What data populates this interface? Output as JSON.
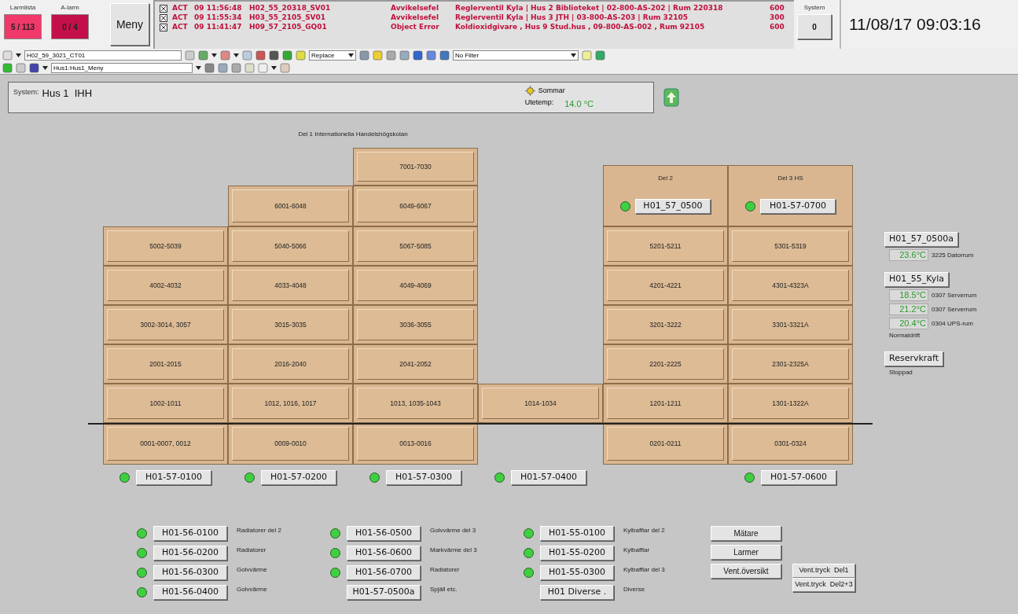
{
  "alarm_counters": [
    {
      "label": "Larmlista",
      "value": "5 / 113",
      "color": "#f0386a"
    },
    {
      "label": "A-larm",
      "value": "0 / 4",
      "color": "#c4104a"
    }
  ],
  "menu_button": "Meny",
  "alarms": [
    {
      "state": "ACT",
      "time": "09 11:56:48",
      "tag": "H02_55_20318_SV01",
      "type": "Avvikelsefel",
      "description": "Reglerventil Kyla  | Hus 2 Biblioteket | 02-800-AS-202 | Rum 220318",
      "priority": "600"
    },
    {
      "state": "ACT",
      "time": "09 11:55:34",
      "tag": "H03_55_2105_SV01",
      "type": "Avvikelsefel",
      "description": "Reglerventil Kyla  | Hus 3 JTH | 03-800-AS-203 | Rum 32105",
      "priority": "300"
    },
    {
      "state": "ACT",
      "time": "09 11:41:47",
      "tag": "H09_57_2105_GQ01",
      "type": "Object Error",
      "description": "Koldioxidgivare , Hus 9 Stud.hus , 09-800-AS-002 , Rum 92105",
      "priority": "600"
    }
  ],
  "system_box": {
    "label": "System",
    "value": "0"
  },
  "clock": "11/08/17 09:03:16",
  "toolbar": {
    "object_field": "H02_59_3021_CT01",
    "replace": "Replace",
    "filter": "No Filter",
    "path_field": "Hus1:Hus1_Meny"
  },
  "system_bar": {
    "label": "System:",
    "name": "Hus 1  IHH",
    "season": "Sommar",
    "temp_label": "Utetemp:",
    "temp": "14.0 °C"
  },
  "building": {
    "title": "Del 1  Internationella Handelshögskolan",
    "columns": [
      {
        "rooms": [
          "5002-5039",
          "4002-4032",
          "3002-3014, 3057",
          "2001-2015",
          "1002-1011",
          "0001-0007, 0012"
        ],
        "ground_floor": true,
        "controller": {
          "label": "H01-57-0100",
          "on": true
        }
      },
      {
        "rooms": [
          "6001-6048",
          "5040-5066",
          "4033-4048",
          "3015-3035",
          "2016-2040",
          "1012, 1016, 1017",
          "0009-0010"
        ],
        "ground_floor": true,
        "controller": {
          "label": "H01-57-0200",
          "on": true
        }
      },
      {
        "rooms": [
          "7001-7030",
          "6049-6067",
          "5067-5085",
          "4049-4069",
          "3036-3055",
          "2041-2052",
          "1013, 1035-1043",
          "0013-0016"
        ],
        "ground_floor": true,
        "controller": {
          "label": "H01-57-0300",
          "on": true
        }
      },
      {
        "rooms": [
          "1014-1034"
        ],
        "ground_floor": false,
        "controller": {
          "label": "H01-57-0400",
          "on": true
        }
      },
      {
        "header": {
          "title": "Del 2",
          "controller": {
            "label": "H01_57_0500",
            "on": true
          }
        },
        "rooms": [
          "5201-5211",
          "4201-4221",
          "3201-3222",
          "2201-2225",
          "1201-1211",
          "0201-0211"
        ],
        "ground_floor": true
      },
      {
        "header": {
          "title": "Del 3 HS",
          "controller": {
            "label": "H01-57-0700",
            "on": true
          }
        },
        "rooms": [
          "5301-5319",
          "4301-4323A",
          "3301-3321A",
          "2301-2325A",
          "1301-1322A",
          "0301-0324"
        ],
        "ground_floor": true,
        "controller": {
          "label": "H01-57-0600",
          "on": true
        }
      }
    ]
  },
  "side_panel": [
    {
      "button": "H01_57_0500a",
      "readings": [
        {
          "value": "23.6°C",
          "label": "3225 Datorrum"
        }
      ]
    },
    {
      "button": "H01_55_Kyla",
      "readings": [
        {
          "value": "18.5°C",
          "label": "0307 Serverrum"
        },
        {
          "value": "21.2°C",
          "label": "0307 Serverrum"
        },
        {
          "value": "20.4°C",
          "label": "0304 UPS-rum"
        }
      ],
      "status": "Normaldrift"
    },
    {
      "button": "Reservkraft",
      "status": "Stoppad"
    }
  ],
  "bottom_groups": [
    {
      "rows": [
        {
          "kind": "led",
          "button": "H01-56-0100",
          "on": true,
          "text": "Radiatorer del 2"
        },
        {
          "kind": "led",
          "button": "H01-56-0200",
          "on": true,
          "text": "Radiatorer"
        },
        {
          "kind": "led",
          "button": "H01-56-0300",
          "on": true,
          "text": "Golvvärme"
        },
        {
          "kind": "led",
          "button": "H01-56-0400",
          "on": true,
          "text": "Golvvärme"
        }
      ]
    },
    {
      "rows": [
        {
          "kind": "led",
          "button": "H01-56-0500",
          "on": true,
          "text": "Golvvärme del 3"
        },
        {
          "kind": "led",
          "button": "H01-56-0600",
          "on": true,
          "text": "Markvärme del 3"
        },
        {
          "kind": "led",
          "button": "H01-56-0700",
          "on": true,
          "text": "Radiatorer"
        },
        {
          "kind": "plain",
          "button": "H01-57-0500a",
          "text": "Spjäll etc."
        }
      ]
    },
    {
      "rows": [
        {
          "kind": "led",
          "button": "H01-55-0100",
          "on": true,
          "text": "Kylbafflar del 2"
        },
        {
          "kind": "led",
          "button": "H01-55-0200",
          "on": true,
          "text": "Kylbafflar"
        },
        {
          "kind": "led",
          "button": "H01-55-0300",
          "on": true,
          "text": "Kylbafflar del 3"
        },
        {
          "kind": "plain",
          "button": "H01 Diverse .",
          "text": "Diverse"
        }
      ]
    }
  ],
  "menu_buttons": [
    "Mätare",
    "Larmer",
    "Vent.översikt"
  ],
  "vent_buttons": [
    "Vent.tryck  Del1",
    "Vent.tryck  Del2+3"
  ]
}
